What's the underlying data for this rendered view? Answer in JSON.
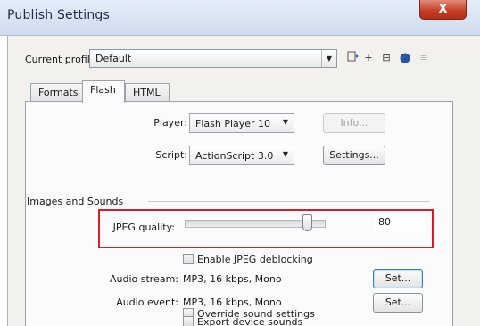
{
  "window": {
    "title": "Publish Settings",
    "close_glyph": "X"
  },
  "profile": {
    "label": "Current profile:",
    "value": "Default",
    "tools": [
      "+",
      "⊟",
      "⬤",
      "≡"
    ]
  },
  "tabs": [
    {
      "label": "Formats"
    },
    {
      "label": "Flash",
      "active": true
    },
    {
      "label": "HTML"
    }
  ],
  "flash": {
    "player": {
      "label": "Player:",
      "value": "Flash Player 10",
      "button": "Info..."
    },
    "script": {
      "label": "Script:",
      "value": "ActionScript 3.0",
      "button": "Settings..."
    },
    "group_title": "Images and Sounds",
    "jpeg_quality": {
      "label": "JPEG quality:",
      "value": "80",
      "slider_level": 0.9
    },
    "enable_deblocking": "Enable JPEG deblocking",
    "audio_stream": {
      "label": "Audio stream:",
      "value": "MP3, 16 kbps, Mono",
      "button": "Set..."
    },
    "audio_event": {
      "label": "Audio event:",
      "value": "MP3, 16 kbps, Mono",
      "button": "Set..."
    },
    "override_sound": "Override sound settings",
    "export_device_sounds": "Export device sounds"
  },
  "colors": {
    "highlight": "#d21f2d",
    "close_button": "#c43b24"
  }
}
